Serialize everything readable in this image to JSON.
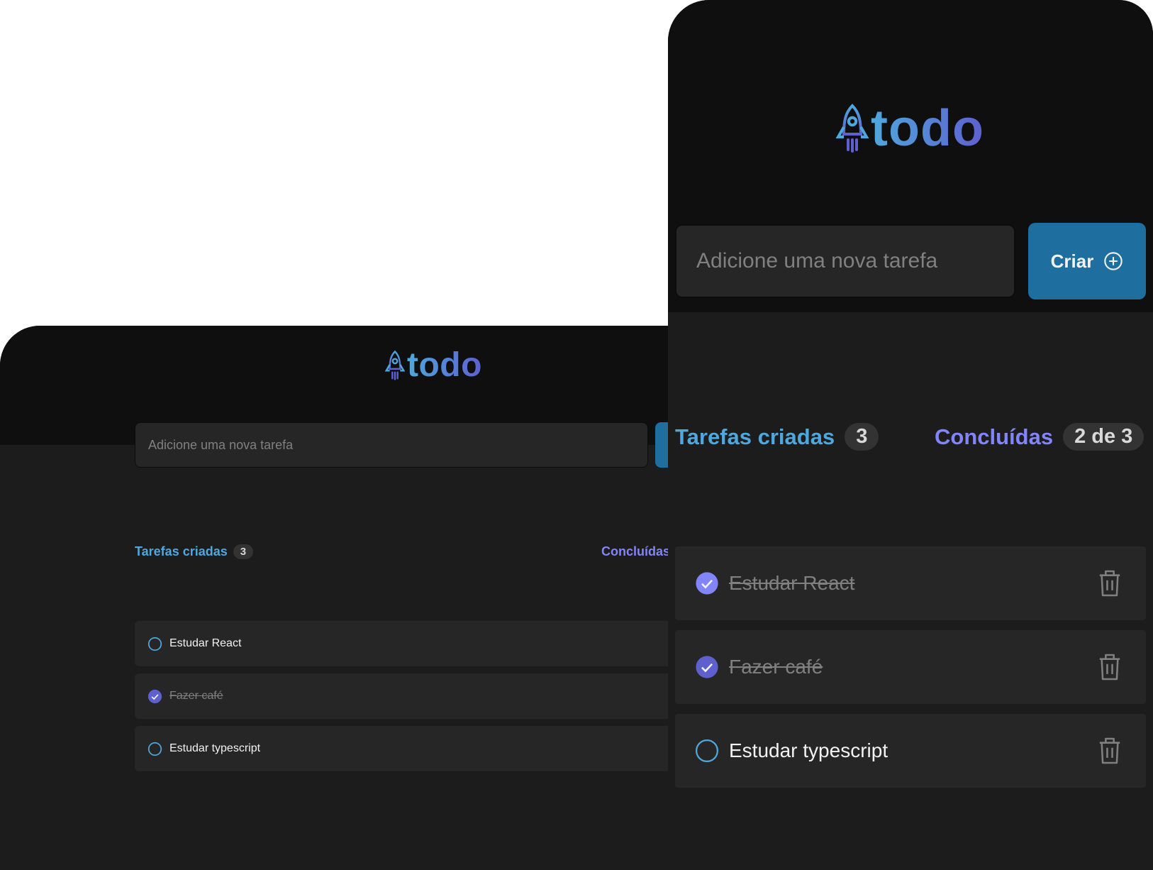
{
  "app": {
    "logo_text": "todo"
  },
  "back_window": {
    "input_placeholder": "Adicione uma nova tarefa",
    "stats": {
      "created_label": "Tarefas criadas",
      "created_count": "3",
      "done_label": "Concluídas"
    },
    "tasks": [
      {
        "text": "Estudar React",
        "done": false
      },
      {
        "text": "Fazer café",
        "done": true
      },
      {
        "text": "Estudar typescript",
        "done": false
      }
    ]
  },
  "front_window": {
    "input_placeholder": "Adicione uma nova tarefa",
    "create_button_label": "Criar",
    "stats": {
      "created_label": "Tarefas criadas",
      "created_count": "3",
      "done_label": "Concluídas",
      "done_count": "2 de 3"
    },
    "tasks": [
      {
        "text": "Estudar React",
        "done": true
      },
      {
        "text": "Fazer café",
        "done": true
      },
      {
        "text": "Estudar typescript",
        "done": false
      }
    ]
  },
  "colors": {
    "blue": "#4ea8de",
    "purple": "#8284fa",
    "purple_dark": "#5e60ce",
    "button": "#1e6f9f",
    "surface": "#262626",
    "background": "#1c1c1c",
    "header": "#0f0f0f"
  },
  "icons": [
    "rocket-icon",
    "plus-circle-icon",
    "check-circle-icon",
    "empty-circle-icon",
    "trash-icon"
  ]
}
